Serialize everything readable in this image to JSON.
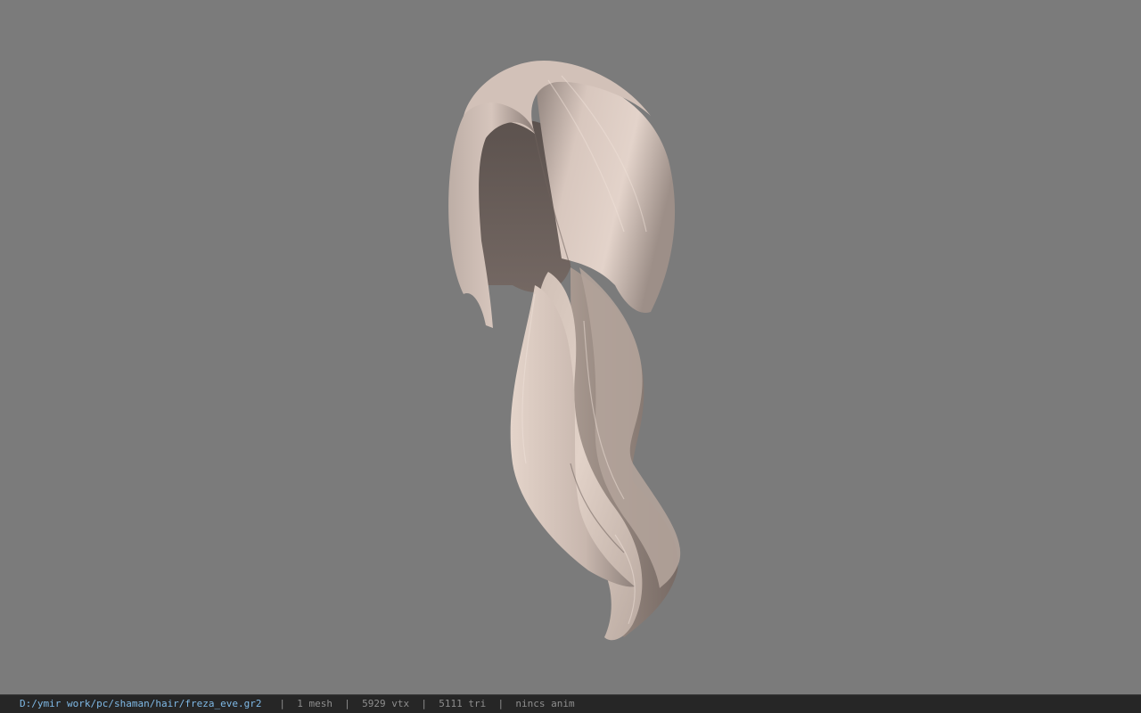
{
  "viewer": {
    "background_color": "#7b7b7b",
    "model_icon": "hair-mesh-model",
    "hair_base_color": "#d9c6bc",
    "hair_shadow_color": "#6d5f59"
  },
  "status_bar": {
    "file_path": "D:/ymir work/pc/shaman/hair/freza_eve.gr2",
    "mesh_count": "1 mesh",
    "vertex_count": "5929 vtx",
    "triangle_count": "5111 tri",
    "anim_status": "nincs anim",
    "separator": "|"
  }
}
